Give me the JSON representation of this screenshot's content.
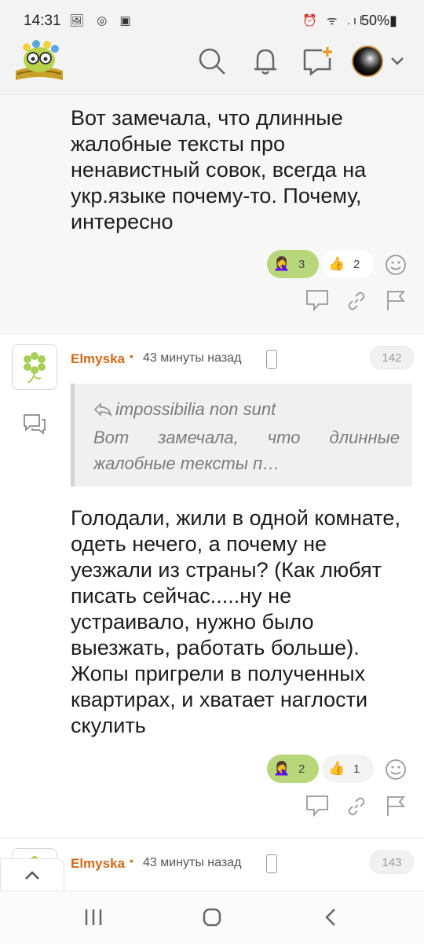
{
  "status_bar": {
    "time": "14:31",
    "left_icons": "🖼 ◎ ▣",
    "right_icons": "⏰ ᯤ .ıl",
    "battery": "50%▮"
  },
  "header": {
    "logo_name": "owl-books-logo",
    "icons": [
      "search-icon",
      "bell-icon",
      "new-post-icon",
      "avatar",
      "chevron-down-icon"
    ]
  },
  "prev_post": {
    "text": "Вот замечала, что длинные жалобные тексты про ненавистный совок, всегда на укр.языке почему-то. Почему, интересно",
    "reactions": [
      {
        "emoji": "🤦‍♀️",
        "count": "3"
      },
      {
        "emoji": "👍",
        "count": "2"
      }
    ]
  },
  "comment1": {
    "author": "Elmyska",
    "time": "43 минуты назад",
    "number": "142",
    "quote_author": "impossibilia non sunt",
    "quote_text": "Вот замечала, что длинные жалобные тексты п…",
    "text": "Голодали, жили в одной комнате, одеть нечего, а почему не уезжали из страны? (Как любят писать сейчас.....ну не устраивало, нужно было выезжать, работать больше). Жопы пригрели в полученных квартирах, и хватает наглости скулить",
    "reactions": [
      {
        "emoji": "🤦‍♀️",
        "count": "2"
      },
      {
        "emoji": "👍",
        "count": "1"
      }
    ]
  },
  "comment2": {
    "author": "Elmyska",
    "time": "43 минуты назад",
    "number": "143"
  },
  "colors": {
    "accent": "#d06a19",
    "reaction_green": "#b7d77a",
    "background_gray": "#f3f3f3"
  }
}
